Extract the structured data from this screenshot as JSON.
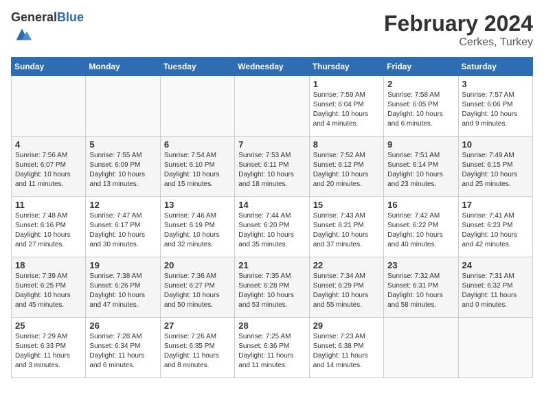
{
  "logo": {
    "general": "General",
    "blue": "Blue"
  },
  "title": {
    "month_year": "February 2024",
    "location": "Cerkes, Turkey"
  },
  "weekdays": [
    "Sunday",
    "Monday",
    "Tuesday",
    "Wednesday",
    "Thursday",
    "Friday",
    "Saturday"
  ],
  "weeks": [
    [
      {
        "day": "",
        "info": ""
      },
      {
        "day": "",
        "info": ""
      },
      {
        "day": "",
        "info": ""
      },
      {
        "day": "",
        "info": ""
      },
      {
        "day": "1",
        "info": "Sunrise: 7:59 AM\nSunset: 6:04 PM\nDaylight: 10 hours and 4 minutes."
      },
      {
        "day": "2",
        "info": "Sunrise: 7:58 AM\nSunset: 6:05 PM\nDaylight: 10 hours and 6 minutes."
      },
      {
        "day": "3",
        "info": "Sunrise: 7:57 AM\nSunset: 6:06 PM\nDaylight: 10 hours and 9 minutes."
      }
    ],
    [
      {
        "day": "4",
        "info": "Sunrise: 7:56 AM\nSunset: 6:07 PM\nDaylight: 10 hours and 11 minutes."
      },
      {
        "day": "5",
        "info": "Sunrise: 7:55 AM\nSunset: 6:09 PM\nDaylight: 10 hours and 13 minutes."
      },
      {
        "day": "6",
        "info": "Sunrise: 7:54 AM\nSunset: 6:10 PM\nDaylight: 10 hours and 15 minutes."
      },
      {
        "day": "7",
        "info": "Sunrise: 7:53 AM\nSunset: 6:11 PM\nDaylight: 10 hours and 18 minutes."
      },
      {
        "day": "8",
        "info": "Sunrise: 7:52 AM\nSunset: 6:12 PM\nDaylight: 10 hours and 20 minutes."
      },
      {
        "day": "9",
        "info": "Sunrise: 7:51 AM\nSunset: 6:14 PM\nDaylight: 10 hours and 23 minutes."
      },
      {
        "day": "10",
        "info": "Sunrise: 7:49 AM\nSunset: 6:15 PM\nDaylight: 10 hours and 25 minutes."
      }
    ],
    [
      {
        "day": "11",
        "info": "Sunrise: 7:48 AM\nSunset: 6:16 PM\nDaylight: 10 hours and 27 minutes."
      },
      {
        "day": "12",
        "info": "Sunrise: 7:47 AM\nSunset: 6:17 PM\nDaylight: 10 hours and 30 minutes."
      },
      {
        "day": "13",
        "info": "Sunrise: 7:46 AM\nSunset: 6:19 PM\nDaylight: 10 hours and 32 minutes."
      },
      {
        "day": "14",
        "info": "Sunrise: 7:44 AM\nSunset: 6:20 PM\nDaylight: 10 hours and 35 minutes."
      },
      {
        "day": "15",
        "info": "Sunrise: 7:43 AM\nSunset: 6:21 PM\nDaylight: 10 hours and 37 minutes."
      },
      {
        "day": "16",
        "info": "Sunrise: 7:42 AM\nSunset: 6:22 PM\nDaylight: 10 hours and 40 minutes."
      },
      {
        "day": "17",
        "info": "Sunrise: 7:41 AM\nSunset: 6:23 PM\nDaylight: 10 hours and 42 minutes."
      }
    ],
    [
      {
        "day": "18",
        "info": "Sunrise: 7:39 AM\nSunset: 6:25 PM\nDaylight: 10 hours and 45 minutes."
      },
      {
        "day": "19",
        "info": "Sunrise: 7:38 AM\nSunset: 6:26 PM\nDaylight: 10 hours and 47 minutes."
      },
      {
        "day": "20",
        "info": "Sunrise: 7:36 AM\nSunset: 6:27 PM\nDaylight: 10 hours and 50 minutes."
      },
      {
        "day": "21",
        "info": "Sunrise: 7:35 AM\nSunset: 6:28 PM\nDaylight: 10 hours and 53 minutes."
      },
      {
        "day": "22",
        "info": "Sunrise: 7:34 AM\nSunset: 6:29 PM\nDaylight: 10 hours and 55 minutes."
      },
      {
        "day": "23",
        "info": "Sunrise: 7:32 AM\nSunset: 6:31 PM\nDaylight: 10 hours and 58 minutes."
      },
      {
        "day": "24",
        "info": "Sunrise: 7:31 AM\nSunset: 6:32 PM\nDaylight: 11 hours and 0 minutes."
      }
    ],
    [
      {
        "day": "25",
        "info": "Sunrise: 7:29 AM\nSunset: 6:33 PM\nDaylight: 11 hours and 3 minutes."
      },
      {
        "day": "26",
        "info": "Sunrise: 7:28 AM\nSunset: 6:34 PM\nDaylight: 11 hours and 6 minutes."
      },
      {
        "day": "27",
        "info": "Sunrise: 7:26 AM\nSunset: 6:35 PM\nDaylight: 11 hours and 8 minutes."
      },
      {
        "day": "28",
        "info": "Sunrise: 7:25 AM\nSunset: 6:36 PM\nDaylight: 11 hours and 11 minutes."
      },
      {
        "day": "29",
        "info": "Sunrise: 7:23 AM\nSunset: 6:38 PM\nDaylight: 11 hours and 14 minutes."
      },
      {
        "day": "",
        "info": ""
      },
      {
        "day": "",
        "info": ""
      }
    ]
  ]
}
